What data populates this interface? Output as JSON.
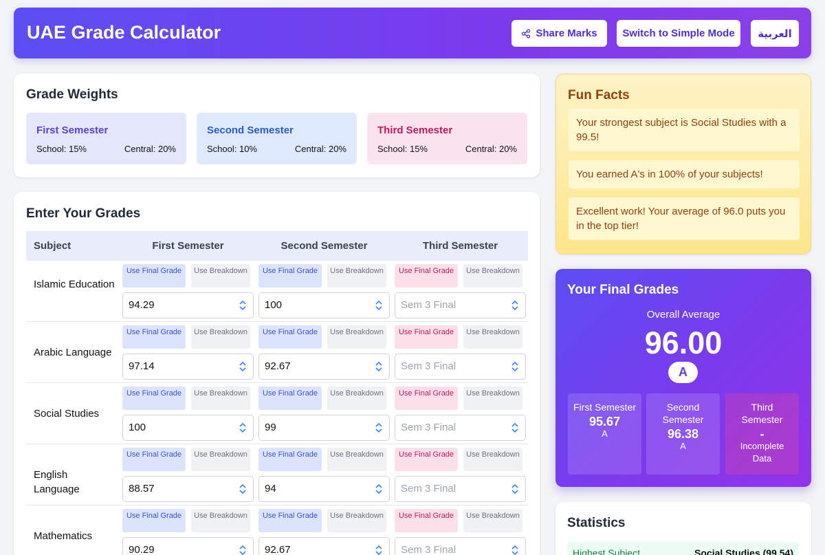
{
  "header": {
    "title": "UAE Grade Calculator",
    "share_label": "Share Marks",
    "mode_label": "Switch to Simple Mode",
    "lang_label": "العربية"
  },
  "weights": {
    "title": "Grade Weights",
    "items": [
      {
        "name": "First Semester",
        "school": "School: 15%",
        "central": "Central: 20%"
      },
      {
        "name": "Second Semester",
        "school": "School: 10%",
        "central": "Central: 20%"
      },
      {
        "name": "Third Semester",
        "school": "School: 15%",
        "central": "Central: 20%"
      }
    ]
  },
  "grades": {
    "title": "Enter Your Grades",
    "columns": [
      "Subject",
      "First Semester",
      "Second Semester",
      "Third Semester"
    ],
    "toggle_final": "Use Final Grade",
    "toggle_breakdown": "Use Breakdown",
    "placeholder": "Sem 3 Final",
    "rows": [
      {
        "subject": "Islamic Education",
        "s1": "94.29",
        "s2": "100",
        "s3": ""
      },
      {
        "subject": "Arabic Language",
        "s1": "97.14",
        "s2": "92.67",
        "s3": ""
      },
      {
        "subject": "Social Studies",
        "s1": "100",
        "s2": "99",
        "s3": ""
      },
      {
        "subject": "English Language",
        "s1": "88.57",
        "s2": "94",
        "s3": ""
      },
      {
        "subject": "Mathematics",
        "s1": "90.29",
        "s2": "92.67",
        "s3": ""
      }
    ]
  },
  "fun_facts": {
    "title": "Fun Facts",
    "items": [
      "Your strongest subject is Social Studies with a 99.5!",
      "You earned A's in 100% of your subjects!",
      "Excellent work! Your average of 96.0 puts you in the top tier!"
    ]
  },
  "final": {
    "title": "Your Final Grades",
    "overall_label": "Overall Average",
    "overall_value": "96.00",
    "overall_letter": "A",
    "semesters": [
      {
        "name": "First Semester",
        "value": "95.67",
        "letter": "A"
      },
      {
        "name": "Second Semester",
        "value": "96.38",
        "letter": "A"
      },
      {
        "name": "Third Semester",
        "value": "-",
        "letter": "Incomplete Data"
      }
    ]
  },
  "stats": {
    "title": "Statistics",
    "highest_label": "Highest Subject",
    "highest_value": "Social Studies (99.54)"
  },
  "colors": {
    "accent": "#6d3ff0",
    "sem1": "#5b3fd8",
    "sem2": "#2b59d6",
    "sem3": "#c2185b"
  }
}
